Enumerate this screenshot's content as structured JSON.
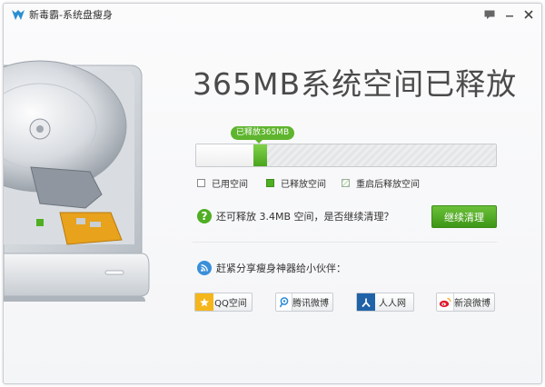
{
  "window": {
    "title": "新毒霸-系统盘瘦身"
  },
  "headline": "365MB系统空间已释放",
  "progress": {
    "bubble_label": "已释放365MB",
    "used_fraction": 0.19,
    "released_fraction": 0.045
  },
  "legend": {
    "used": "已用空间",
    "released": "已释放空间",
    "reboot": "重启后释放空间"
  },
  "question": "还可释放 3.4MB 空间，是否继续清理？",
  "continue_button": "继续清理",
  "share_prompt": "赶紧分享瘦身神器给小伙伴：",
  "share_buttons": {
    "qq": "QQ空间",
    "tencent": "腾讯微博",
    "renren": "人人网",
    "sina": "新浪微博"
  },
  "colors": {
    "accent_green": "#4fae22",
    "headline": "#4a4a4a"
  }
}
